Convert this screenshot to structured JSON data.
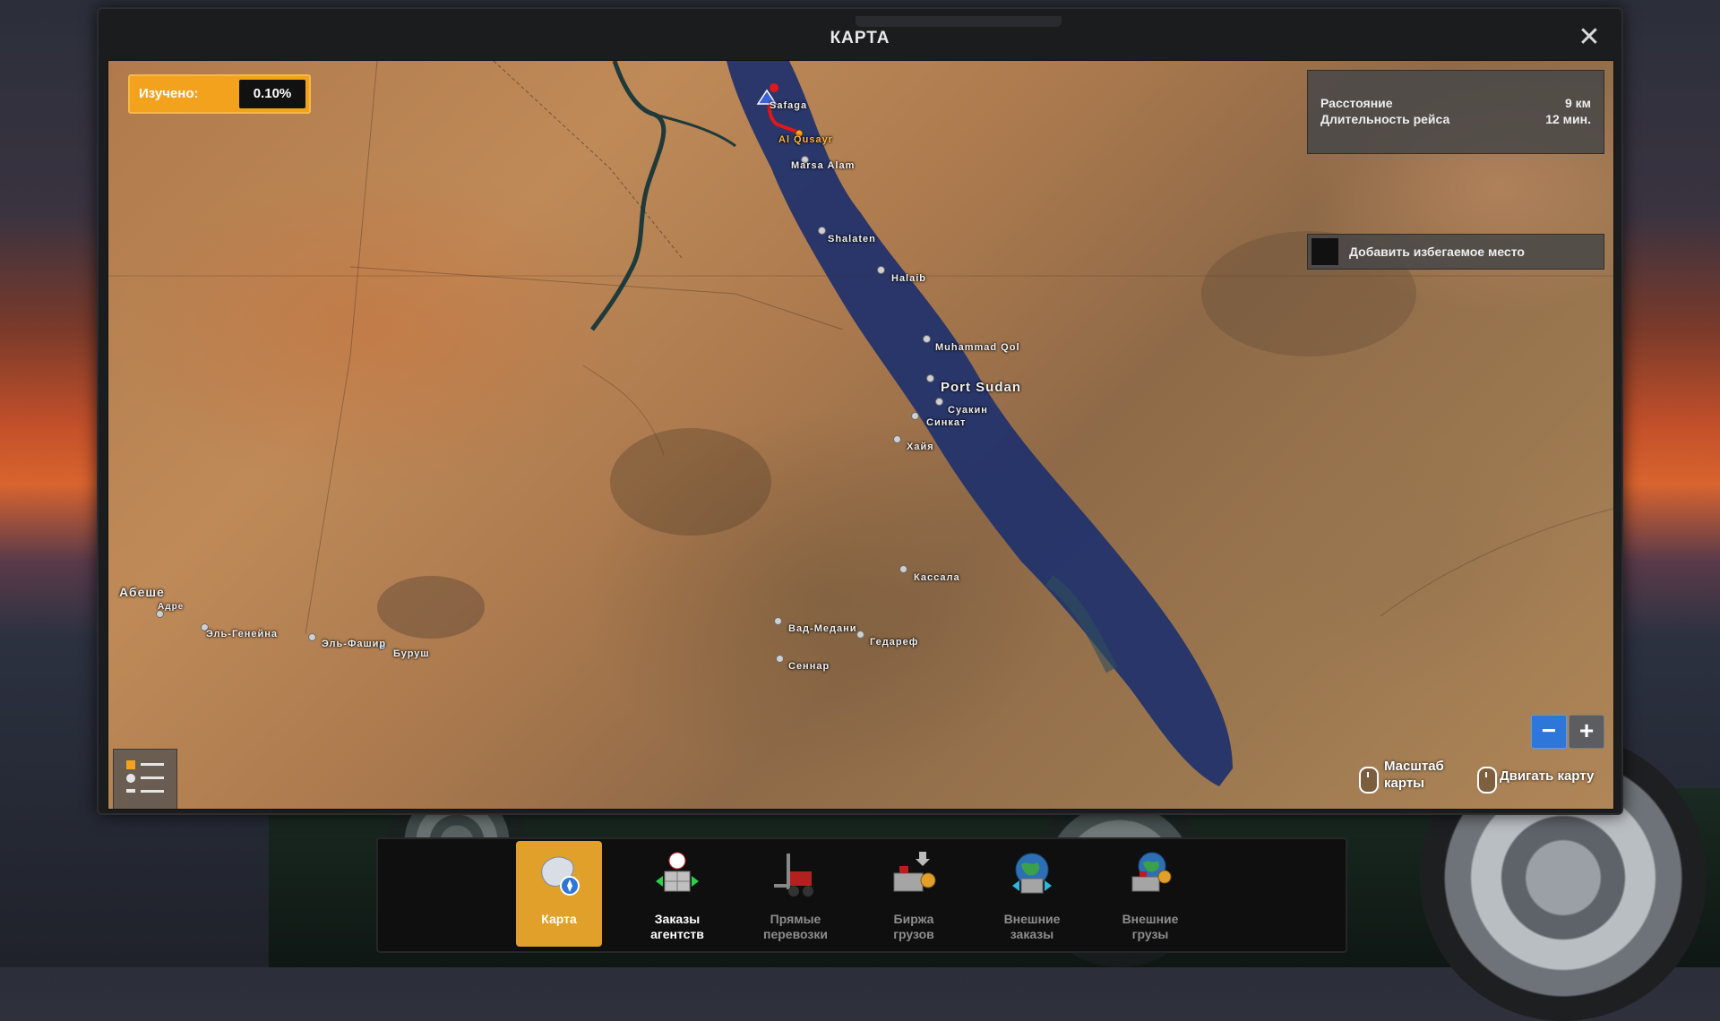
{
  "window": {
    "title": "КАРТА"
  },
  "explored": {
    "label": "Изучено:",
    "value": "0.10%"
  },
  "route_info": {
    "distance_label": "Расстояние",
    "distance_value": "9 км",
    "duration_label": "Длительность рейса",
    "duration_value": "12 мин."
  },
  "avoid": {
    "label": "Добавить избегаемое место"
  },
  "cities": {
    "safaga": "Safaga",
    "al_qusayr": "Al Qusayr",
    "marsa_alam": "Marsa Alam",
    "shalaten": "Shalaten",
    "halaib": "Halaib",
    "muhammad_qol": "Muhammad Qol",
    "port_sudan": "Port Sudan",
    "suakin": "Суакин",
    "sinkat": "Синкат",
    "haya": "Хайя",
    "kassala": "Кассала",
    "wad_medani": "Вад-Медани",
    "gedaref": "Гедареф",
    "sennar": "Сеннар",
    "abeshe": "Абеше",
    "adre": "Адре",
    "el_geneina": "Эль-Генейна",
    "el_fasher": "Эль-Фашир",
    "burush": "Буруш"
  },
  "hints": {
    "zoom_line1": "Масштаб",
    "zoom_line2": "карты",
    "move": "Двигать карту"
  },
  "toolbar": {
    "items": [
      {
        "label": "Карта",
        "icon": "europe-map-icon"
      },
      {
        "label": "Заказы\nагентств",
        "icon": "agency-orders-icon"
      },
      {
        "label": "Прямые\nперевозки",
        "icon": "forklift-icon"
      },
      {
        "label": "Биржа\nгрузов",
        "icon": "freight-market-icon"
      },
      {
        "label": "Внешние\nзаказы",
        "icon": "globe-orders-icon"
      },
      {
        "label": "Внешние\nгрузы",
        "icon": "globe-cargo-icon"
      }
    ]
  },
  "colors": {
    "accent": "#e0a02a",
    "zoom_active": "#2d77d8",
    "route": "#e01818",
    "sea": "#23336b"
  }
}
